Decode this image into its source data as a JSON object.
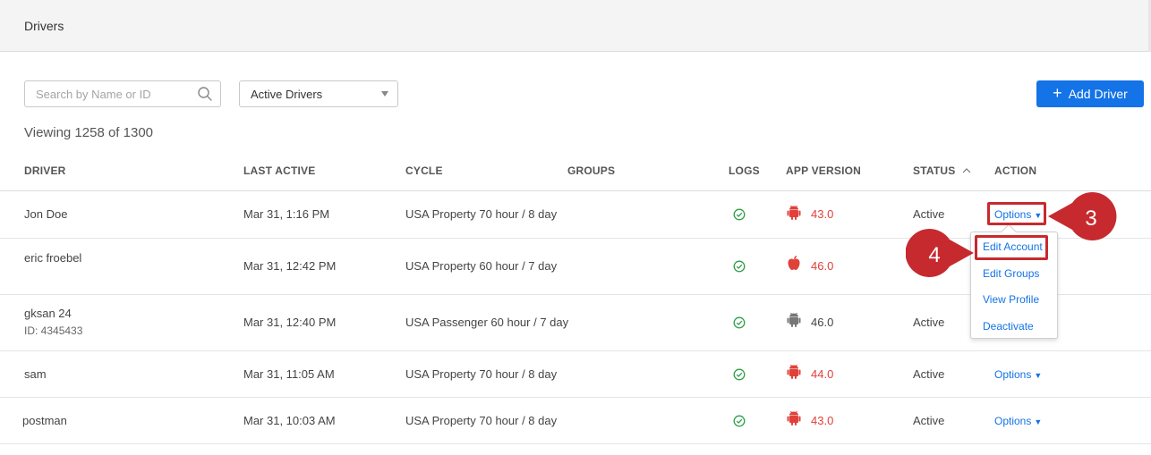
{
  "page": {
    "title": "Drivers"
  },
  "toolbar": {
    "search_placeholder": "Search by Name or ID",
    "filter_value": "Active Drivers",
    "add_button_label": "Add Driver",
    "add_button_icon": "plus-icon"
  },
  "viewing_text": "Viewing 1258 of 1300",
  "table": {
    "headers": {
      "driver": "DRIVER",
      "last_active": "LAST ACTIVE",
      "cycle": "CYCLE",
      "groups": "GROUPS",
      "logs": "LOGS",
      "app_version": "APP VERSION",
      "status": "STATUS",
      "action": "ACTION"
    },
    "status_sort_indicator": "^",
    "rows": [
      {
        "driver": "Jon Doe",
        "driver_id": "",
        "last_active": "Mar 31, 1:16 PM",
        "cycle": "USA Property 70 hour / 8 day",
        "groups": "",
        "logs_icon": "check-circle-icon",
        "os_icon": "android-icon",
        "app_version": "43.0",
        "version_color": "#e0413a",
        "status": "Active",
        "action": "Options"
      },
      {
        "driver": "eric froebel",
        "driver_id": "",
        "last_active": "Mar 31, 12:42 PM",
        "cycle": "USA Property 60 hour / 7 day",
        "groups": "",
        "logs_icon": "check-circle-icon",
        "os_icon": "apple-icon",
        "app_version": "46.0",
        "version_color": "#e0413a",
        "status": "",
        "action": ""
      },
      {
        "driver": "gksan 24",
        "driver_id": "ID: 4345433",
        "last_active": "Mar 31, 12:40 PM",
        "cycle": "USA Passenger 60 hour / 7 day",
        "groups": "",
        "logs_icon": "check-circle-icon",
        "os_icon": "android-icon",
        "app_version": "46.0",
        "version_color": "#444444",
        "status": "Active",
        "action": ""
      },
      {
        "driver": "sam",
        "driver_id": "",
        "last_active": "Mar 31, 11:05 AM",
        "cycle": "USA Property 70 hour / 8 day",
        "groups": "",
        "logs_icon": "check-circle-icon",
        "os_icon": "android-icon",
        "app_version": "44.0",
        "version_color": "#e0413a",
        "status": "Active",
        "action": "Options"
      },
      {
        "driver": "postman",
        "driver_id": "",
        "last_active": "Mar 31, 10:03 AM",
        "cycle": "USA Property 70 hour / 8 day",
        "groups": "",
        "logs_icon": "check-circle-icon",
        "os_icon": "android-icon",
        "app_version": "43.0",
        "version_color": "#e0413a",
        "status": "Active",
        "action": "Options"
      }
    ]
  },
  "options_menu": {
    "items": [
      "Edit Account",
      "Edit Groups",
      "View Profile",
      "Deactivate"
    ]
  },
  "callouts": {
    "step_3": "3",
    "step_4": "4",
    "color": "#c62a2f"
  },
  "colors": {
    "accent": "#1473e6",
    "check": "#2e9e48",
    "warning_red": "#e0413a"
  }
}
